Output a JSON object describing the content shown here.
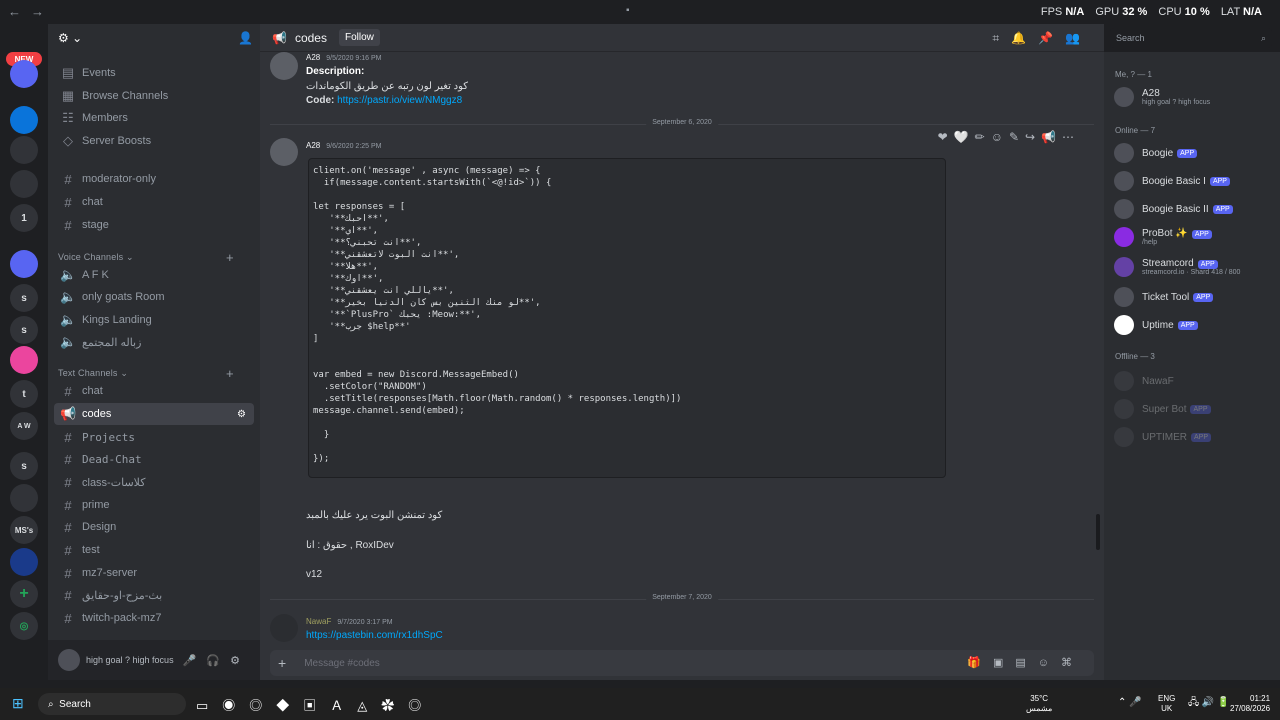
{
  "topbar": {
    "fps_label": "FPS",
    "fps": "N/A",
    "gpu_label": "GPU",
    "gpu": "32 %",
    "cpu_label": "CPU",
    "cpu": "10 %",
    "lat_label": "LAT",
    "lat": "N/A"
  },
  "rail": {
    "new_badge": "NEW",
    "items": [
      "1",
      "s",
      "s",
      "t",
      "A W",
      "s",
      "MS's",
      "s"
    ]
  },
  "sidebar": {
    "channels": [
      {
        "icon": "calendar-icon",
        "label": "Events"
      },
      {
        "icon": "browse-icon",
        "label": "Browse Channels"
      },
      {
        "icon": "members-icon",
        "label": "Members"
      },
      {
        "icon": "boost-icon",
        "label": "Server Boosts"
      },
      {
        "icon": "hash",
        "label": "moderator-only"
      },
      {
        "icon": "hash",
        "label": "chat"
      },
      {
        "icon": "hash",
        "label": "stage"
      }
    ],
    "voice_category": "Voice Channels",
    "voice": [
      {
        "label": "A F K"
      },
      {
        "label": "only goats Room"
      },
      {
        "label": "Kings Landing"
      },
      {
        "label": "زباله المجتمع"
      }
    ],
    "text_category": "Text Channels",
    "text": [
      {
        "label": "chat",
        "active": false
      },
      {
        "label": "codes",
        "active": true
      },
      {
        "label": "Projects",
        "active": false
      },
      {
        "label": "Dead-Chat",
        "active": false
      },
      {
        "label": "class-كلاسات",
        "active": false
      },
      {
        "label": "prime",
        "active": false
      },
      {
        "label": "Design",
        "active": false
      },
      {
        "label": "test",
        "active": false
      },
      {
        "label": "mz7-server",
        "active": false
      },
      {
        "label": "بث-مزح-او-حقايق",
        "active": false
      },
      {
        "label": "twitch-pack-mz7",
        "active": false
      }
    ],
    "user_status": "high goal ? high focus"
  },
  "header": {
    "channel": "codes",
    "follow": "Follow"
  },
  "messages": {
    "m1": {
      "author": "A28",
      "time": "9/5/2020 9:16 PM",
      "desc_label": "Description:",
      "desc": "كود تغير لون رتبه عن طريق الكوماندات",
      "code_label": "Code:",
      "code_link": "https://pastr.io/view/NMggz8"
    },
    "date1": "September 6, 2020",
    "m2": {
      "author": "A28",
      "time": "9/6/2020 2:25 PM",
      "code": "client.on('message' , async (message) => {\n  if(message.content.startsWith(`<@!id>`)) {\n\nlet responses = [\n   '**احبك**',\n   '**اي**',\n   '**انت تحبني؟**',\n   '**انت البوت لاتعشقني**',\n   '**هلا**',\n   '**اوك**',\n   '**ياللي انت يعشقني**',\n   '**لو منك الثنين بس كان الدنيا بخير**',\n   '**`PlusPro` يحبك :Meow:**',\n   '**جرب $help**'\n]\n\n\nvar embed = new Discord.MessageEmbed()\n  .setColor(\"RANDOM\")\n  .setTitle(responses[Math.floor(Math.random() * responses.length)])\nmessage.channel.send(embed);\n\n  }\n\n});",
      "line1": "كود تمنشن البوت يرد عليك بالمبد",
      "line2": "حقوق : انا , RoxIDev",
      "line3": "v12"
    },
    "date2": "September 7, 2020",
    "m3": {
      "author": "NawaF",
      "time": "9/7/2020 3:17 PM",
      "link": "https://pastebin.com/rx1dhSpC"
    }
  },
  "composer": {
    "placeholder": "Message #codes"
  },
  "search": {
    "placeholder": "Search"
  },
  "members": {
    "me_group": "Me, ? — 1",
    "me": {
      "name": "A28",
      "status": "high goal ? high focus"
    },
    "online_group": "Online — 7",
    "online": [
      {
        "name": "Boogie",
        "sub": ""
      },
      {
        "name": "Boogie Basic I",
        "sub": ""
      },
      {
        "name": "Boogie Basic II",
        "sub": ""
      },
      {
        "name": "ProBot ✨",
        "sub": "/help"
      },
      {
        "name": "Streamcord",
        "sub": "streamcord.io · Shard 418 / 800"
      },
      {
        "name": "Ticket Tool",
        "sub": ""
      },
      {
        "name": "Uptime",
        "sub": ""
      }
    ],
    "app_badge": "APP",
    "offline_group": "Offline — 3",
    "offline": [
      {
        "name": "NawaF"
      },
      {
        "name": "Super Bot"
      },
      {
        "name": "UPTIMER"
      }
    ]
  },
  "taskbar": {
    "search": "Search",
    "weather": "35°C",
    "weather_sub": "مشمس",
    "lang": "ENG",
    "lang_sub": "UK",
    "time": "01:21",
    "date": "27/08/2026"
  }
}
